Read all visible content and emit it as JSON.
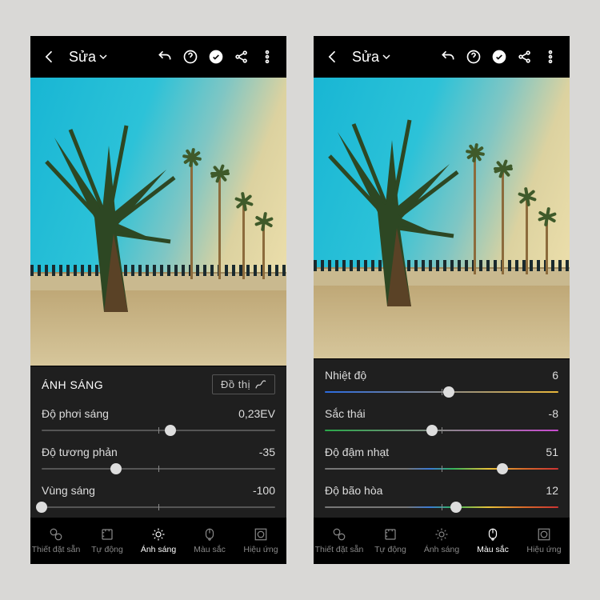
{
  "header": {
    "edit_label": "Sửa"
  },
  "left": {
    "panel_title": "ÁNH SÁNG",
    "graph_label": "Đồ thị",
    "sliders": [
      {
        "label": "Độ phơi sáng",
        "value": "0,23EV",
        "pos": 55
      },
      {
        "label": "Độ tương phản",
        "value": "-35",
        "pos": 32
      },
      {
        "label": "Vùng sáng",
        "value": "-100",
        "pos": 0
      }
    ],
    "nav": [
      "Thiết đặt sẵn",
      "Tự động",
      "Ánh sáng",
      "Màu sắc",
      "Hiệu ứng"
    ],
    "active_nav": 2
  },
  "right": {
    "sliders": [
      {
        "label": "Nhiệt độ",
        "value": "6",
        "pos": 53,
        "grad": "g-temp"
      },
      {
        "label": "Sắc thái",
        "value": "-8",
        "pos": 46,
        "grad": "g-tint"
      },
      {
        "label": "Độ đậm nhạt",
        "value": "51",
        "pos": 76,
        "grad": "g-vib"
      },
      {
        "label": "Độ bão hòa",
        "value": "12",
        "pos": 56,
        "grad": "g-sat"
      }
    ],
    "nav": [
      "Thiết đặt sẵn",
      "Tự động",
      "Ánh sáng",
      "Màu sắc",
      "Hiệu ứng"
    ],
    "active_nav": 3
  }
}
